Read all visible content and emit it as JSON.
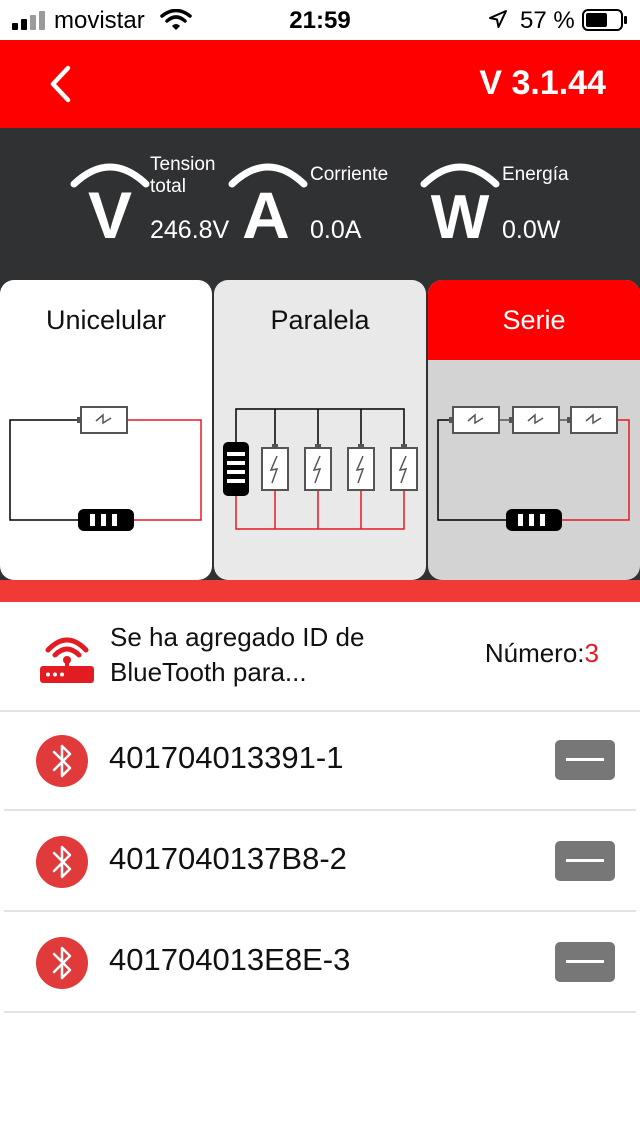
{
  "status_bar": {
    "carrier": "movistar",
    "time": "21:59",
    "battery_percent": "57 %",
    "icons": [
      "signal-icon",
      "wifi-icon",
      "location-arrow-icon",
      "battery-icon"
    ]
  },
  "header": {
    "back_icon": "chevron-left-icon",
    "version": "V 3.1.44",
    "background": "#ff0000"
  },
  "meters": [
    {
      "icon": "V",
      "label_line1": "Tension",
      "label_line2": "total",
      "value": "246.8V"
    },
    {
      "icon": "A",
      "label_line1": "Corriente",
      "label_line2": "",
      "value": "0.0A"
    },
    {
      "icon": "W",
      "label_line1": "Energía",
      "label_line2": "",
      "value": "0.0W"
    }
  ],
  "modes": {
    "items": [
      {
        "label": "Unicelular",
        "selected": false
      },
      {
        "label": "Paralela",
        "selected": false
      },
      {
        "label": "Serie",
        "selected": true
      }
    ],
    "accent": "#ff0000"
  },
  "devices": {
    "message": "Se ha agregado ID de BlueTooth para...",
    "count_label": "Número:",
    "count_value": "3",
    "items": [
      {
        "id": "401704013391-1"
      },
      {
        "id": "4017040137B8-2"
      },
      {
        "id": "401704013E8E-3"
      }
    ],
    "item_icon": "bluetooth-icon",
    "remove_icon": "minus-icon"
  }
}
